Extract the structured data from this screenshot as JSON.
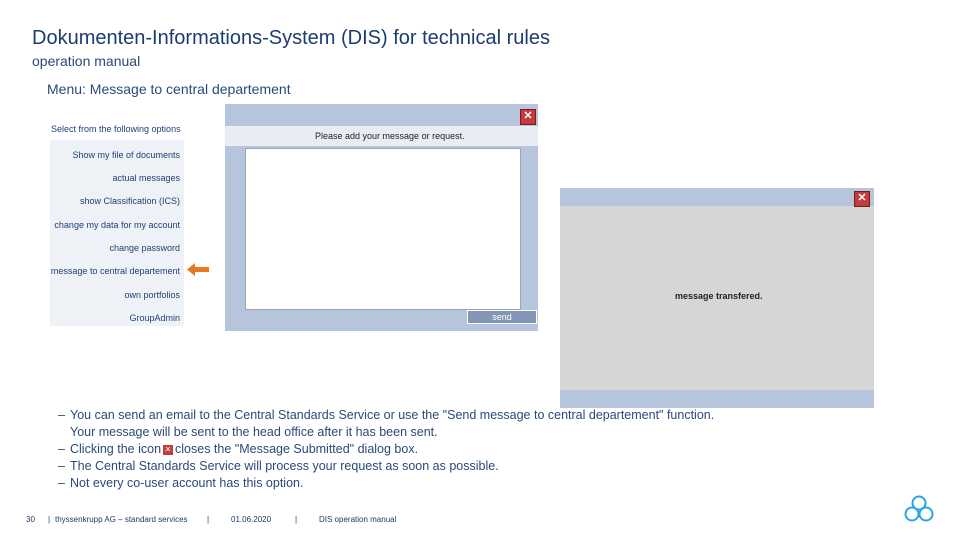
{
  "page": {
    "title": "Dokumenten-Informations-System (DIS) for technical rules",
    "subtitle": "operation manual",
    "menu_caption": "Menu: Message to central departement"
  },
  "options_menu": {
    "heading": "Select from the following options",
    "items": [
      "Show my file of documents",
      "actual messages",
      "show Classification (ICS)",
      "change my data for my account",
      "change password",
      "message to central departement",
      "own portfolios",
      "GroupAdmin"
    ],
    "highlighted_item": "message to central departement"
  },
  "message_dialog": {
    "prompt": "Please add your message or request.",
    "message_value": "",
    "send_label": "send",
    "close_label": "✕"
  },
  "confirm_dialog": {
    "message": "message transfered.",
    "close_label": "✕"
  },
  "bullets": {
    "b1_line1": "You can send an email to the Central Standards Service or use the \"Send message to central departement\" function.",
    "b1_line2": "Your message will be sent to the head office after it has been sent.",
    "b2_before": "Clicking the icon",
    "b2_after": "closes the \"Message Submitted\" dialog box.",
    "b3": "The Central Standards Service will process your request as soon as possible.",
    "b4": "Not every co-user account has this option.",
    "dash": "–"
  },
  "footer": {
    "page_number": "30",
    "company": "thyssenkrupp AG – standard services",
    "date": "01.06.2020",
    "doc": "DIS operation manual",
    "separator": "|"
  },
  "colors": {
    "title": "#1d3c6e",
    "dialog_frame": "#b6c4dc",
    "close_red": "#c33c3c",
    "arrow_orange": "#e87722"
  }
}
